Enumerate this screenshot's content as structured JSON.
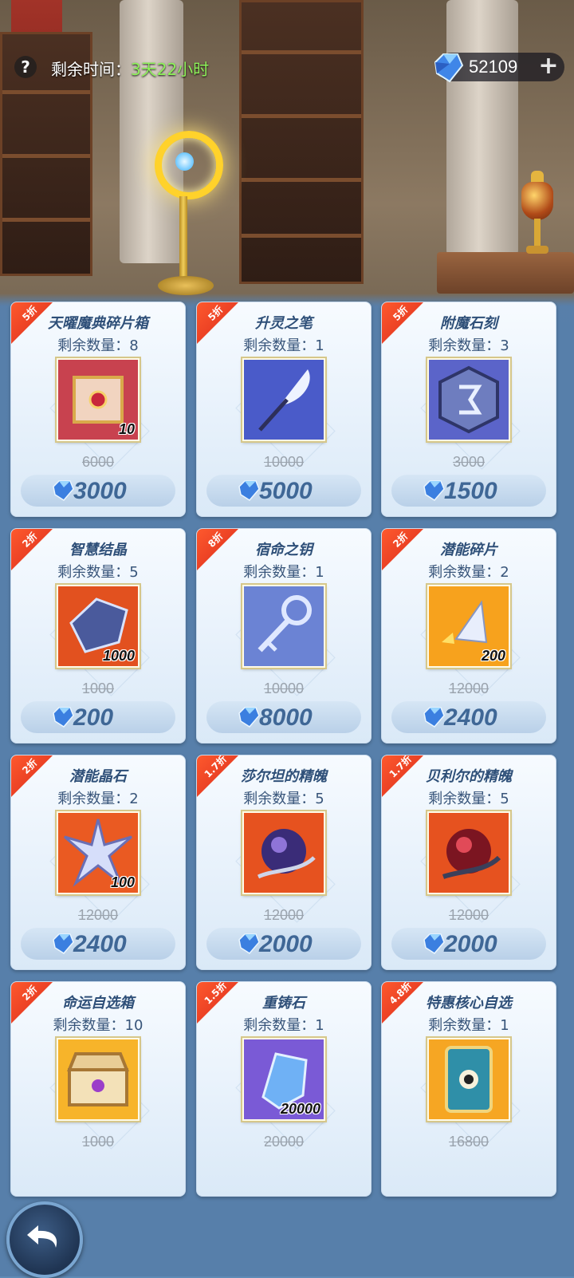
{
  "header": {
    "help_label": "?",
    "timer_label": "剩余时间：",
    "timer_value": "3天22小时",
    "currency_amount": "52109",
    "plus_label": "+"
  },
  "colors": {
    "timer_value": "#8ef25a",
    "price_text": "#3f6796",
    "discount_tag": "#e2371f",
    "gem": "#3d7de0"
  },
  "items": [
    {
      "discount": "5折",
      "name": "天曜魔典碎片箱",
      "stock": "剩余数量：8",
      "qty": "10",
      "old_price": "6000",
      "price": "3000",
      "icon": "treasure-box-icon"
    },
    {
      "discount": "5折",
      "name": "升灵之笔",
      "stock": "剩余数量：1",
      "qty": "",
      "old_price": "10000",
      "price": "5000",
      "icon": "quill-pen-icon"
    },
    {
      "discount": "5折",
      "name": "附魔石刻",
      "stock": "剩余数量：3",
      "qty": "",
      "old_price": "3000",
      "price": "1500",
      "icon": "rune-stone-icon"
    },
    {
      "discount": "2折",
      "name": "智慧结晶",
      "stock": "剩余数量：5",
      "qty": "1000",
      "old_price": "1000",
      "price": "200",
      "icon": "wisdom-crystal-icon"
    },
    {
      "discount": "8折",
      "name": "宿命之钥",
      "stock": "剩余数量：1",
      "qty": "",
      "old_price": "10000",
      "price": "8000",
      "icon": "key-icon"
    },
    {
      "discount": "2折",
      "name": "潜能碎片",
      "stock": "剩余数量：2",
      "qty": "200",
      "old_price": "12000",
      "price": "2400",
      "icon": "potential-shard-icon"
    },
    {
      "discount": "2折",
      "name": "潜能晶石",
      "stock": "剩余数量：2",
      "qty": "100",
      "old_price": "12000",
      "price": "2400",
      "icon": "potential-star-icon"
    },
    {
      "discount": "1.7折",
      "name": "莎尔坦的精魄",
      "stock": "剩余数量：5",
      "qty": "",
      "old_price": "12000",
      "price": "2000",
      "icon": "dark-orb-icon"
    },
    {
      "discount": "1.7折",
      "name": "贝利尔的精魄",
      "stock": "剩余数量：5",
      "qty": "",
      "old_price": "12000",
      "price": "2000",
      "icon": "red-orb-icon"
    },
    {
      "discount": "2折",
      "name": "命运自选箱",
      "stock": "剩余数量：10",
      "qty": "",
      "old_price": "1000",
      "price": "",
      "icon": "fate-chest-icon"
    },
    {
      "discount": "1.5折",
      "name": "重铸石",
      "stock": "剩余数量：1",
      "qty": "20000",
      "old_price": "20000",
      "price": "",
      "icon": "reforge-stone-icon"
    },
    {
      "discount": "4.8折",
      "name": "特惠核心自选",
      "stock": "剩余数量：1",
      "qty": "",
      "old_price": "16800",
      "price": "",
      "icon": "core-card-icon"
    }
  ]
}
